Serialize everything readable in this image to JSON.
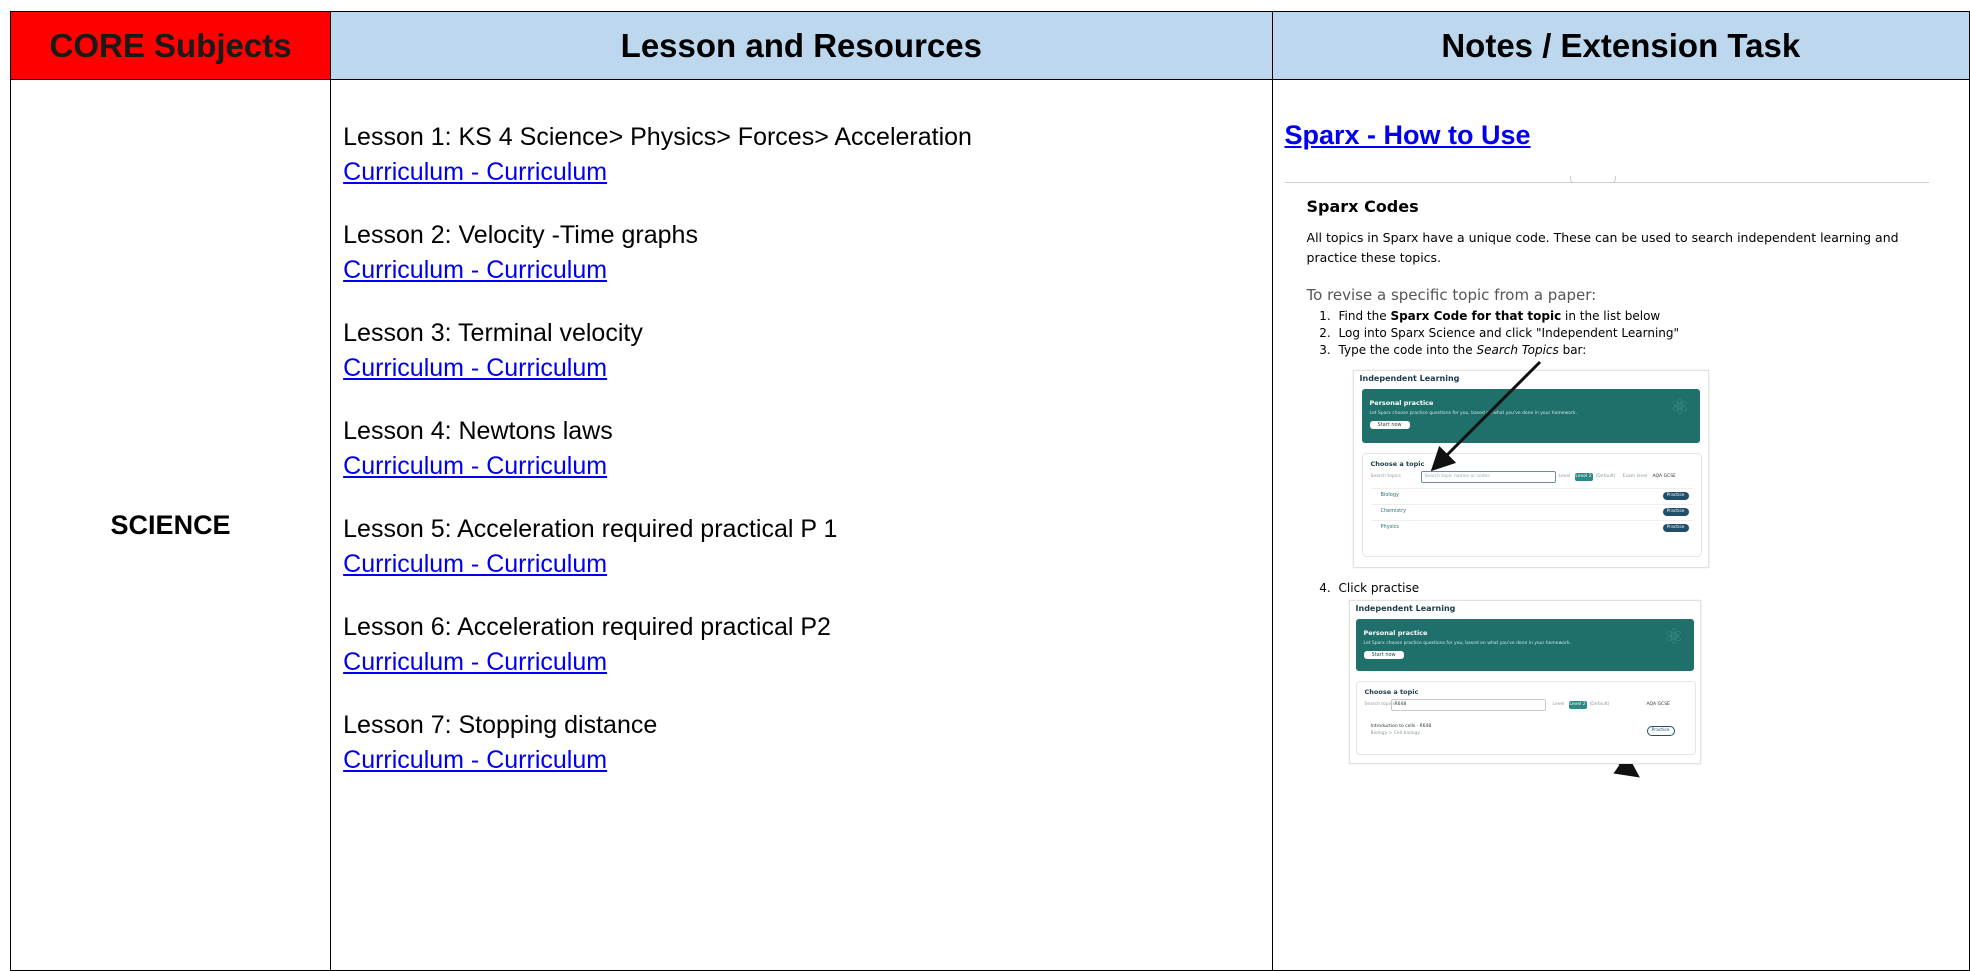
{
  "header": {
    "core": "CORE Subjects",
    "lesson": "Lesson and Resources",
    "notes": "Notes / Extension Task"
  },
  "subject": "SCIENCE",
  "lessons": [
    {
      "title": "Lesson 1: KS 4 Science> Physics> Forces> Acceleration",
      "link": "Curriculum - Curriculum"
    },
    {
      "title": "Lesson 2: Velocity -Time graphs",
      "link": "Curriculum - Curriculum"
    },
    {
      "title": "Lesson 3:  Terminal velocity",
      "link": "Curriculum - Curriculum"
    },
    {
      "title": "Lesson 4: Newtons laws",
      "link": "Curriculum - Curriculum"
    },
    {
      "title": "Lesson 5: Acceleration required practical P 1",
      "link": "Curriculum - Curriculum"
    },
    {
      "title": "Lesson 6: Acceleration required practical P2",
      "link": "Curriculum - Curriculum"
    },
    {
      "title": "Lesson 7: Stopping distance",
      "link": "Curriculum - Curriculum"
    }
  ],
  "notes": {
    "title": "Sparx - How to Use",
    "screenshot": {
      "heading": "Sparx Codes",
      "paragraph": "All topics in Sparx have a unique code. These can be used to search independent learning and practice these topics.",
      "revise": "To revise a specific topic from a paper:",
      "step1_pre": "Find the ",
      "step1_bold": "Sparx Code for that topic",
      "step1_post": " in the list below",
      "step2": "Log into Sparx Science and click \"Independent Learning\"",
      "step3_pre": "Type the code into the ",
      "step3_em": "Search Topics",
      "step3_post": " bar:",
      "step4": "Click practise",
      "panel": {
        "title": "Independent Learning",
        "personal": "Personal practice",
        "personal_desc": "Let Sparx choose practice questions for you, based on what you've done in your homework.",
        "start": "Start now",
        "choose": "Choose a topic",
        "search_label": "Search topics",
        "search_placeholder": "Search topic names or codes",
        "search_value": "R648",
        "level_label": "Level",
        "level_value": "Level 2",
        "default": "(Default)",
        "exam_label": "Exam level",
        "exam_value": "AQA GCSE",
        "topics": [
          "Biology",
          "Chemistry",
          "Physics"
        ],
        "practise": "Practise",
        "result": "Introduction to cells",
        "result_code": "R648",
        "result_sub": "Biology > Cell biology"
      }
    }
  }
}
